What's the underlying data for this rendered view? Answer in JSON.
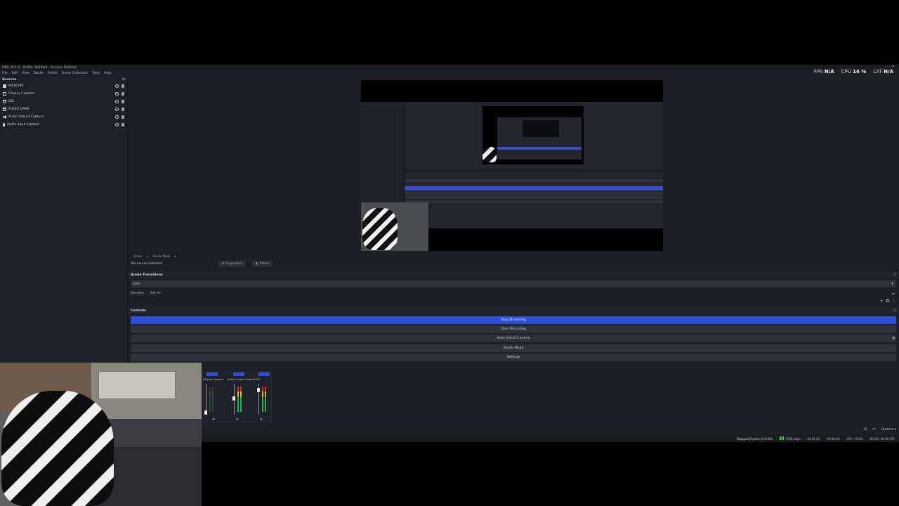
{
  "window": {
    "title": "OBS 30.1.2 - Profile: Untitled - Scenes: Untitled",
    "minimize": "–",
    "close": "×"
  },
  "menu": [
    "File",
    "Edit",
    "View",
    "Docks",
    "Profile",
    "Scene Collection",
    "Tools",
    "Help"
  ],
  "stats": {
    "fps_label": "FPS",
    "fps_value": "N/A",
    "cpu_label": "CPU",
    "cpu_value": "14 %",
    "lat_label": "LAT",
    "lat_value": "N/A"
  },
  "sources": {
    "header": "Sources",
    "items": [
      {
        "label": "WEBCAM",
        "icon": "camera-icon"
      },
      {
        "label": "Display Capture",
        "icon": "monitor-icon"
      },
      {
        "label": "DIS",
        "icon": "window-icon"
      },
      {
        "label": "AUDIO GAME",
        "icon": "window-icon"
      },
      {
        "label": "Audio Output Capture",
        "icon": "speaker-icon"
      },
      {
        "label": "Audio Input Capture",
        "icon": "microphone-icon"
      }
    ]
  },
  "scene_bar": [
    "Scene",
    "+",
    "Studio Mode",
    "▾"
  ],
  "properties": {
    "no_source": "No source selected",
    "properties_button": "Properties",
    "filters_button": "Filters"
  },
  "transitions": {
    "header": "Scene Transitions",
    "selected": "Fade",
    "duration_label": "Duration",
    "duration_value": "300 ms",
    "tools": [
      "+",
      "⧉",
      "⋮"
    ]
  },
  "controls": {
    "header": "Controls",
    "buttons": [
      "Stop Streaming",
      "Start Recording",
      "Start Virtual Camera",
      "Studio Mode",
      "Settings"
    ]
  },
  "mixer": {
    "channels": [
      "Display Capture",
      "Audio Output Capture",
      "DIS"
    ],
    "options_label": "Options",
    "active_color": "#2f4fd6"
  },
  "status": {
    "dropped": "Dropped Frames 0 (0.0%)",
    "bitrate": "2708 kbps",
    "stream_time": "00:02:24",
    "rec_time": "00:00:00",
    "cpu": "CPU: 14.0%",
    "fps": "60.00 / 60.00 FPS"
  },
  "colors": {
    "accent": "#2f4fd6",
    "background": "#1c1f26",
    "panel": "#2d313a"
  }
}
